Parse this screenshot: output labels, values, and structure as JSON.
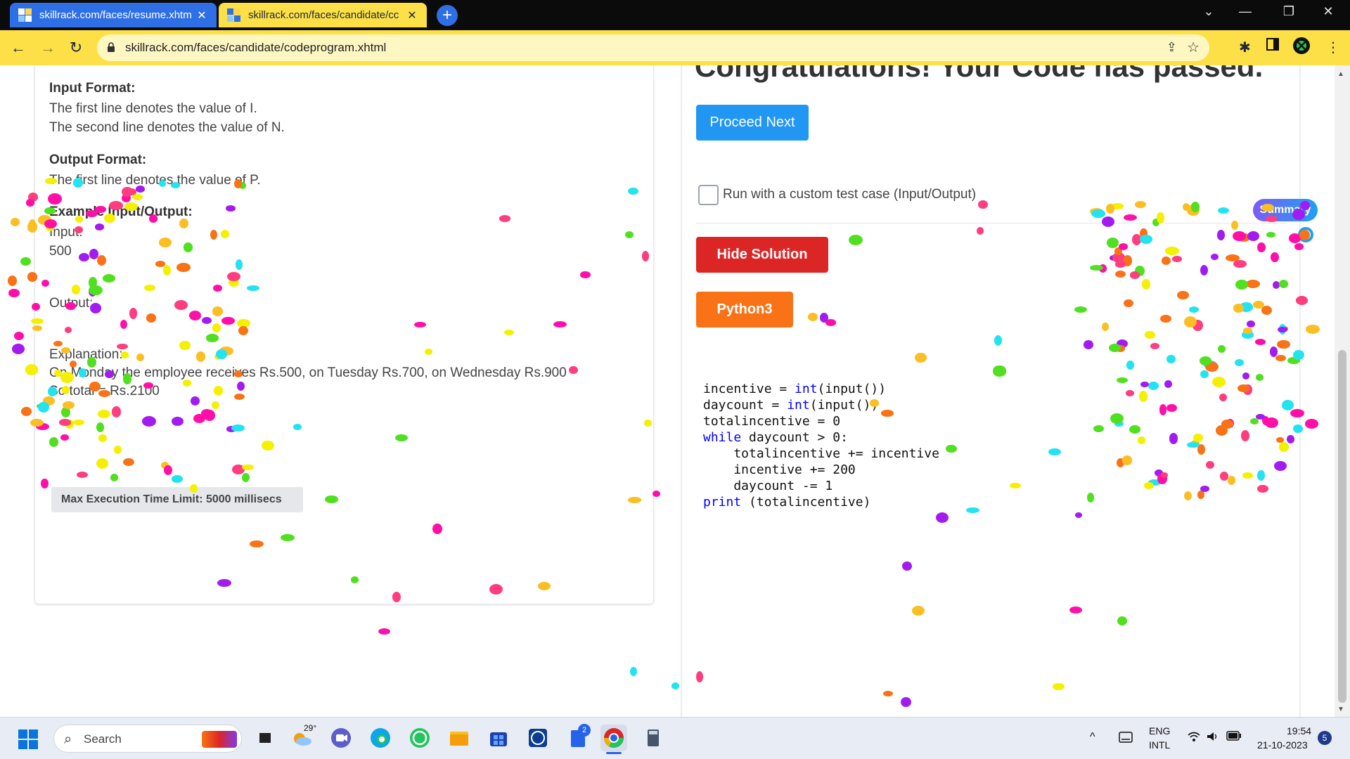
{
  "browser": {
    "tabs": [
      {
        "title": "skillrack.com/faces/resume.xhtm",
        "close": "✕"
      },
      {
        "title": "skillrack.com/faces/candidate/cc",
        "close": "✕"
      }
    ],
    "new_tab": "+",
    "window_controls": {
      "dropdown": "⌄",
      "minimize": "—",
      "restore": "❐",
      "close": "✕"
    },
    "nav": {
      "back": "←",
      "forward": "→",
      "reload": "↻"
    },
    "url": "skillrack.com/faces/candidate/codeprogram.xhtml",
    "toolbar_icons": [
      "share-icon",
      "star-icon",
      "extensions-icon",
      "side-panel-icon",
      "profile-icon",
      "menu-icon"
    ]
  },
  "problem": {
    "input_format_heading": "Input Format:",
    "input_format_lines": [
      "The first line denotes the value of I.",
      "The second line denotes the value of N."
    ],
    "output_format_heading": "Output Format:",
    "output_format_lines": [
      "The first line denotes the value of P."
    ],
    "example_heading": "Example Input/Output:",
    "example_input_label": "Input:",
    "example_input_value": "500",
    "example_output_label": "Output:",
    "example_explanation_label": "Explanation:",
    "explanation_line1": "On Monday the employee receives Rs.500, on Tuesday Rs.700, on Wednesday Rs.900",
    "explanation_line2": "So total = Rs.2100",
    "max_exec_time": "Max Execution Time Limit: 5000 millisecs"
  },
  "result": {
    "congrats": "Congratulations! Your Code has passed.",
    "proceed_button": "Proceed Next",
    "custom_test_label": "Run with a custom test case (Input/Output)",
    "hide_solution_button": "Hide Solution",
    "language_button": "Python3",
    "summary_button": "Summary"
  },
  "code": {
    "line1_var": "incentive = ",
    "line1_fn": "int",
    "line1_fn2": "(input",
    "line1_rest": "())",
    "line2_var": "daycount = ",
    "line2_fn": "int",
    "line2_fn2": "(input",
    "line2_rest": "())",
    "line3": "totalincentive = 0",
    "line4_kw": "while",
    "line4_rest": " daycount > 0:",
    "line5": "    totalincentive += incentive",
    "line6": "    incentive += 200",
    "line7": "    daycount -= 1",
    "line8_kw": "print",
    "line8_rest": " (totalincentive)"
  },
  "taskbar": {
    "search_placeholder": "Search",
    "weather_temp": "29°",
    "language_line1": "ENG",
    "language_line2": "INTL",
    "time": "19:54",
    "date": "21-10-2023",
    "notification_count": "5",
    "store_badge": "2"
  },
  "colors": {
    "tab_active": "#fde047",
    "tab_inactive": "#2f6fe6",
    "proceed": "#2196f3",
    "hide": "#dc2626",
    "language": "#f97316",
    "keyword": "#0000ff"
  }
}
